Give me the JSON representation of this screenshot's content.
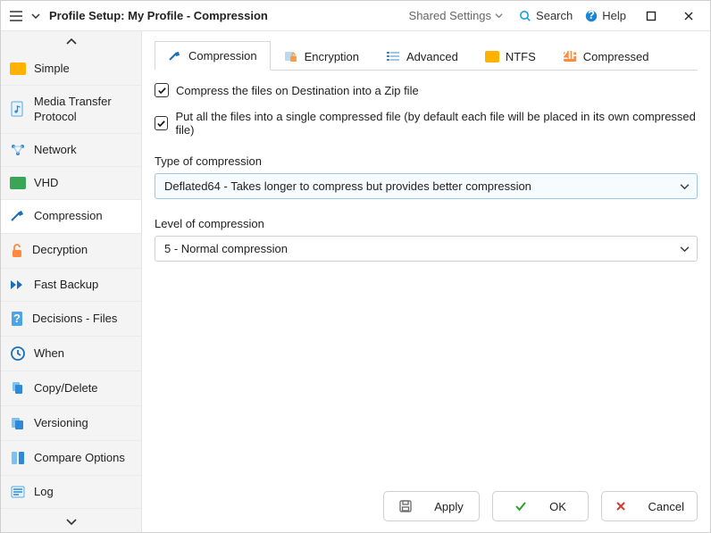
{
  "titlebar": {
    "title": "Profile Setup: My Profile - Compression",
    "shared_label": "Shared Settings",
    "search_label": "Search",
    "help_label": "Help"
  },
  "sidebar": {
    "items": [
      {
        "label": "Simple"
      },
      {
        "label": "Media Transfer Protocol"
      },
      {
        "label": "Network"
      },
      {
        "label": "VHD"
      },
      {
        "label": "Compression"
      },
      {
        "label": "Decryption"
      },
      {
        "label": "Fast Backup"
      },
      {
        "label": "Decisions - Files"
      },
      {
        "label": "When"
      },
      {
        "label": "Copy/Delete"
      },
      {
        "label": "Versioning"
      },
      {
        "label": "Compare Options"
      },
      {
        "label": "Log"
      }
    ]
  },
  "tabs": {
    "items": [
      {
        "label": "Compression"
      },
      {
        "label": "Encryption"
      },
      {
        "label": "Advanced"
      },
      {
        "label": "NTFS"
      },
      {
        "label": "Compressed"
      }
    ]
  },
  "form": {
    "chk1": "Compress the files on Destination into a Zip file",
    "chk2": "Put all the files into a single compressed file (by default each file will be placed in its own compressed file)",
    "type_label": "Type of compression",
    "type_value": "Deflated64 - Takes longer to compress but provides better compression",
    "level_label": "Level of compression",
    "level_value": "5 - Normal compression"
  },
  "footer": {
    "apply": "Apply",
    "ok": "OK",
    "cancel": "Cancel"
  }
}
